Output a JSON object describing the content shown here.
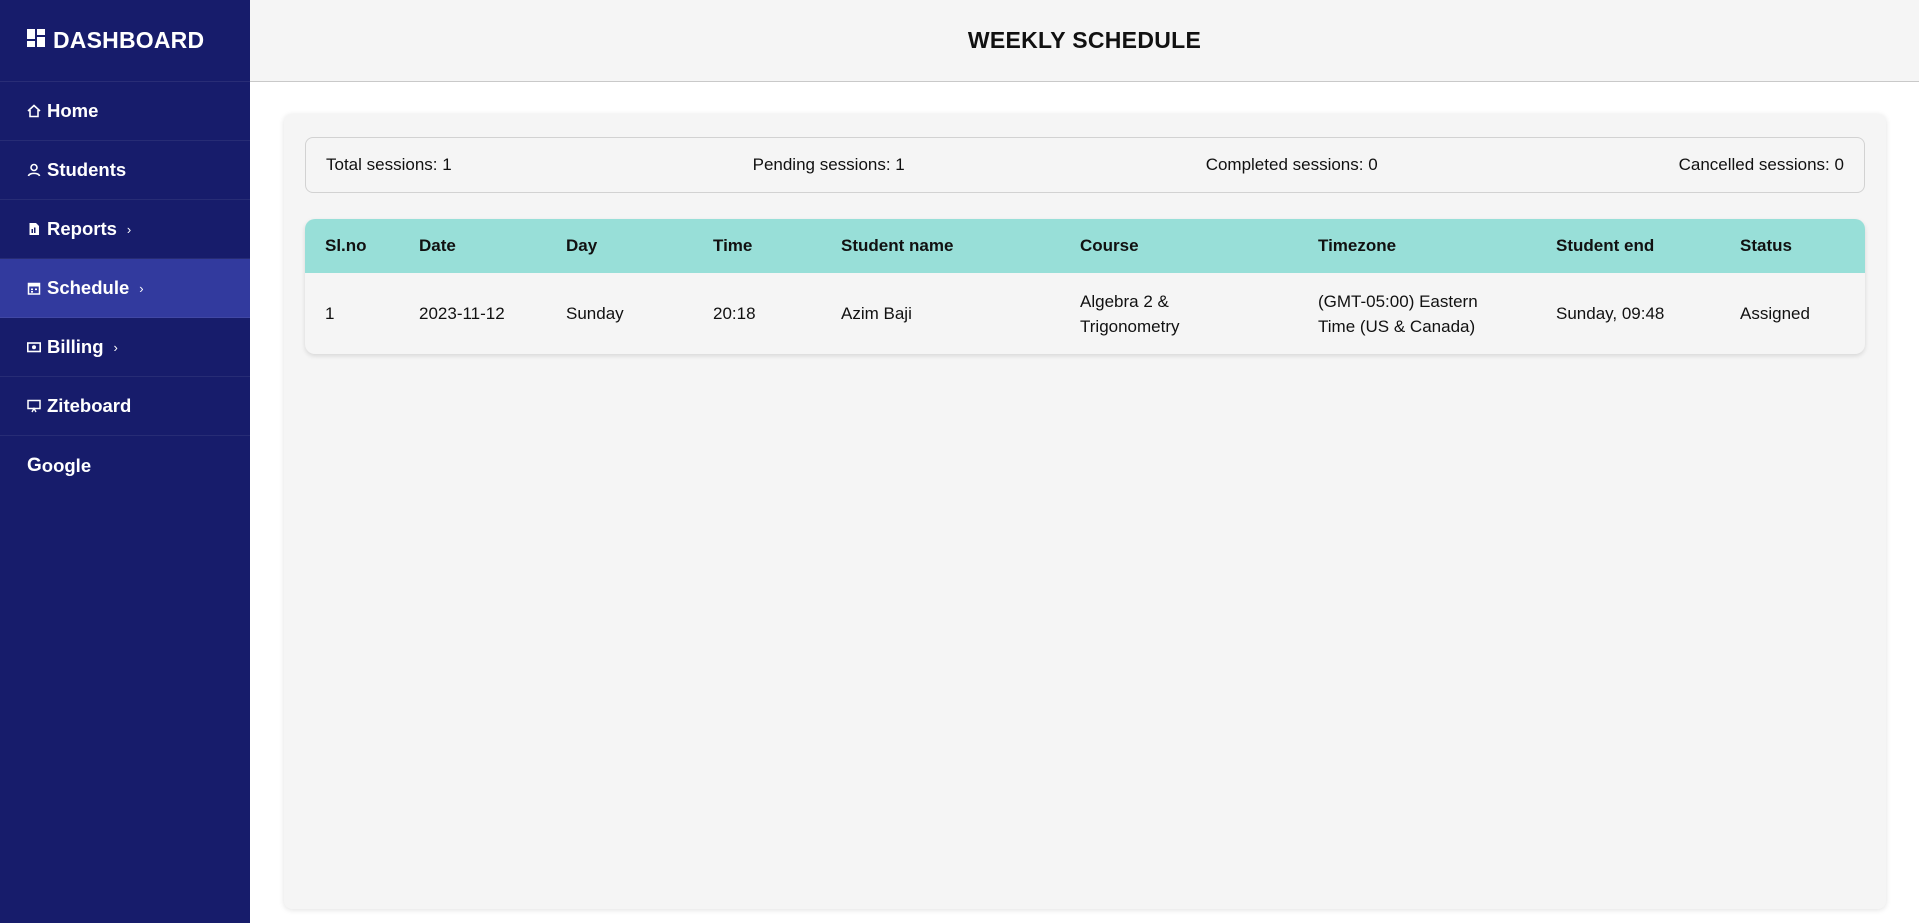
{
  "sidebar": {
    "brand": "DASHBOARD",
    "brand_icon": "dashboard-grid-icon",
    "items": [
      {
        "label": "Home",
        "icon": "home-icon",
        "has_chevron": false,
        "active": false
      },
      {
        "label": "Students",
        "icon": "user-icon",
        "has_chevron": false,
        "active": false
      },
      {
        "label": "Reports",
        "icon": "file-report-icon",
        "has_chevron": true,
        "active": false
      },
      {
        "label": "Schedule",
        "icon": "calendar-icon",
        "has_chevron": true,
        "active": true
      },
      {
        "label": "Billing",
        "icon": "money-icon",
        "has_chevron": true,
        "active": false
      },
      {
        "label": "Ziteboard",
        "icon": "presentation-board-icon",
        "has_chevron": false,
        "active": false
      },
      {
        "label": "oogle",
        "icon": "google-g-icon",
        "icon_letter": "G",
        "has_chevron": false,
        "active": false
      }
    ],
    "chevron": "›"
  },
  "header": {
    "title": "WEEKLY SCHEDULE"
  },
  "summary": {
    "total": "Total sessions: 1",
    "pending": "Pending sessions: 1",
    "completed": "Completed sessions: 0",
    "cancelled": "Cancelled sessions: 0"
  },
  "table": {
    "headers": [
      "Sl.no",
      "Date",
      "Day",
      "Time",
      "Student name",
      "Course",
      "Timezone",
      "Student end",
      "Status"
    ],
    "rows": [
      [
        "1",
        "2023-11-12",
        "Sunday",
        "20:18",
        "Azim Baji",
        "Algebra 2 & Trigonometry",
        "(GMT-05:00) Eastern Time (US & Canada)",
        "Sunday, 09:48",
        "Assigned"
      ]
    ]
  },
  "colors": {
    "sidebar_bg": "#171c6b",
    "sidebar_active": "#323a9e",
    "table_header_bg": "#98dfd8",
    "page_bg": "#f5f5f5"
  }
}
